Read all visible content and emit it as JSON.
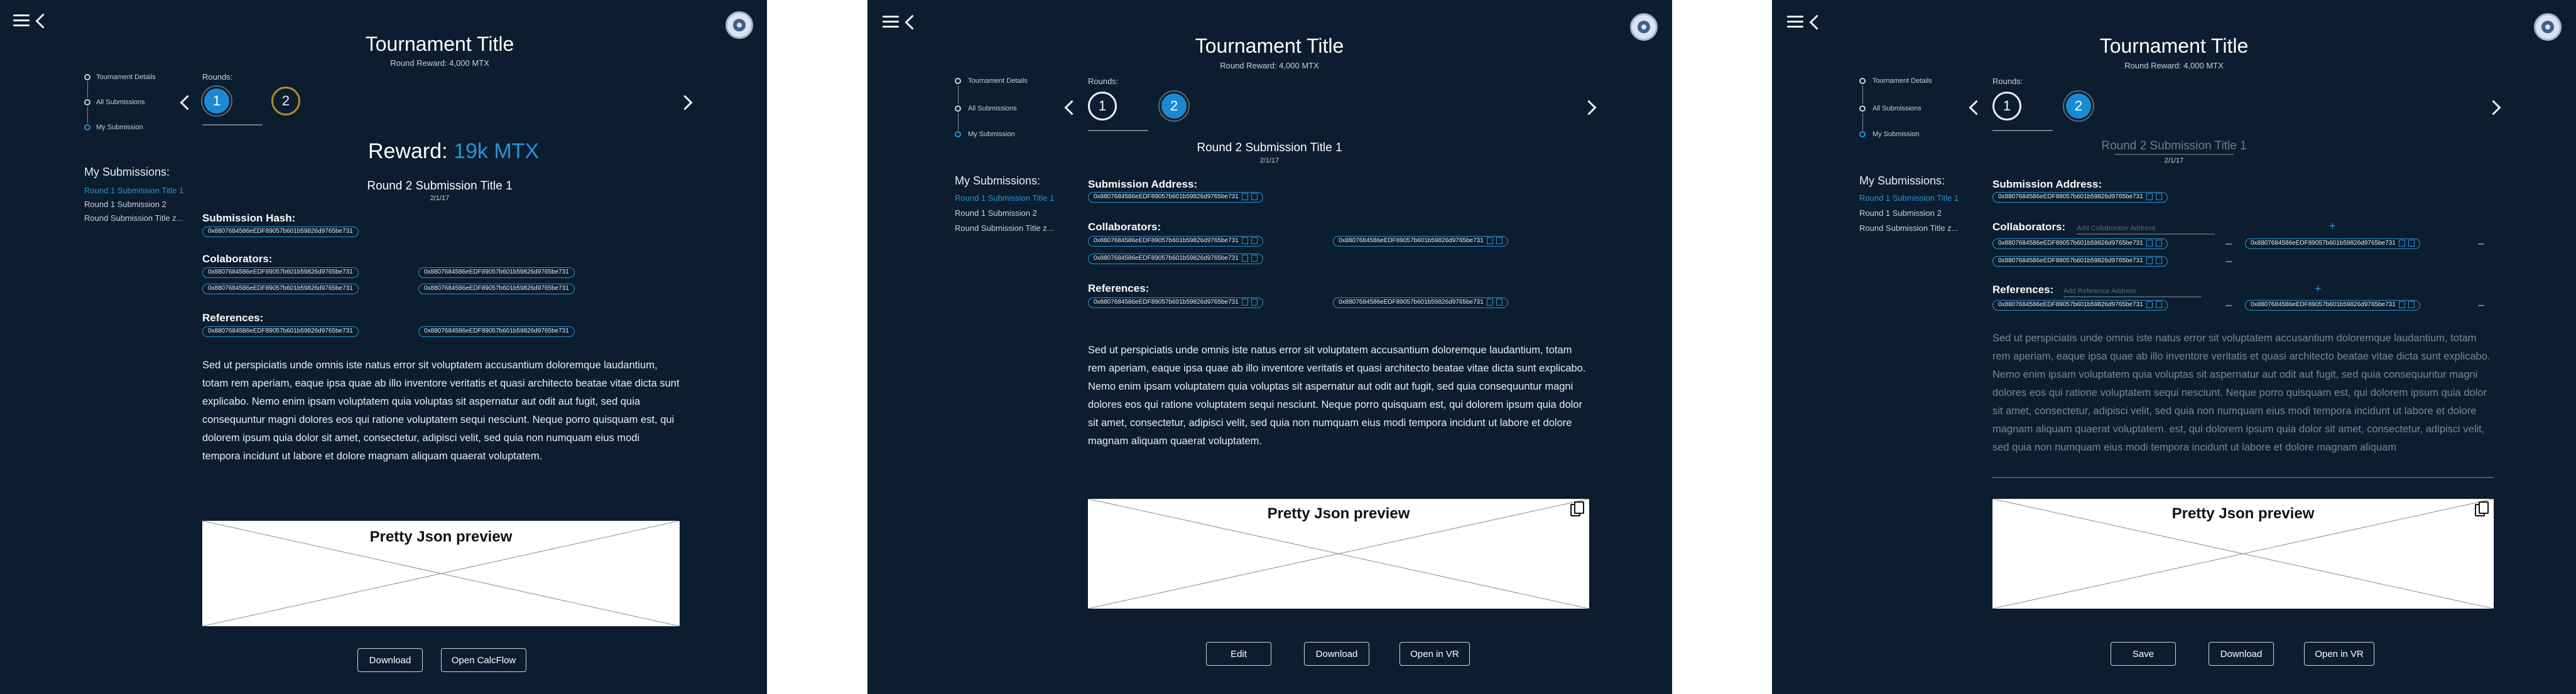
{
  "tournament": {
    "title": "Tournament Title",
    "round_reward": "Round Reward: 4,000 MTX"
  },
  "nav": {
    "tournament_details": "Tournament Details",
    "all_submissions": "All Submissions",
    "my_submission": "My Submission"
  },
  "rounds": {
    "label": "Rounds:",
    "one": "1",
    "two": "2"
  },
  "my_submissions": {
    "heading": "My Submissions:",
    "items": [
      "Round 1 Submission Title 1",
      "Round 1 Submission 2",
      "Round Submission Title z..."
    ]
  },
  "reward": {
    "label": "Reward: ",
    "amount": "19k MTX"
  },
  "submission": {
    "title": "Round 2 Submission Title 1",
    "date": "2/1/17",
    "hash_label": "Submission Hash:",
    "address_label": "Submission Address:",
    "collaborators_label": "Colaborators:",
    "collaborators_label_alt": "Collaborators:",
    "references_label": "References:",
    "hash": "0x8807684586eEDF89057b601b59826d9765be731",
    "add_collaborator_placeholder": "Add Collaborator Address",
    "add_reference_placeholder": "Add Reference Address",
    "description": "Sed ut perspiciatis unde omnis iste natus error sit voluptatem accusantium doloremque laudantium, totam rem aperiam, eaque ipsa quae ab illo inventore veritatis et quasi architecto beatae vitae dicta sunt explicabo. Nemo enim ipsam voluptatem quia voluptas sit aspernatur aut odit aut fugit, sed quia consequuntur magni dolores eos qui ratione voluptatem sequi nesciunt. Neque porro quisquam est, qui dolorem ipsum quia dolor sit amet, consectetur, adipisci velit, sed quia non numquam eius modi tempora incidunt ut labore et dolore magnam aliquam quaerat voluptatem.",
    "description_edit": "Sed ut perspiciatis unde omnis iste natus error sit voluptatem accusantium doloremque laudantium, totam rem aperiam, eaque ipsa quae ab illo inventore veritatis et quasi architecto beatae vitae dicta sunt explicabo. Nemo enim ipsam voluptatem quia voluptas sit aspernatur aut odit aut fugit, sed quia consequuntur magni dolores eos qui ratione voluptatem sequi nesciunt. Neque porro quisquam est, qui dolorem ipsum quia dolor sit amet, consectetur, adipisci velit, sed quia non numquam eius modi tempora incidunt ut labore et dolore magnam aliquam quaerat voluptatem. est, qui dolorem ipsum quia dolor sit amet, consectetur, adipisci velit, sed quia non numquam eius modi tempora incidunt ut labore et dolore magnam aliquam"
  },
  "json_preview": {
    "title": "Pretty Json preview"
  },
  "buttons": {
    "download": "Download",
    "open_calcflow": "Open CalcFlow",
    "edit": "Edit",
    "open_in_vr": "Open in VR",
    "save": "Save"
  },
  "colors": {
    "background": "#0b1d2e",
    "accent": "#2a93d8",
    "gold": "#b7892a"
  },
  "icons": [
    "menu-icon",
    "back-arrow-icon",
    "avatar-icon",
    "chevron-left-icon",
    "chevron-right-icon",
    "copy-icon",
    "external-link-icon",
    "plus-icon",
    "minus-icon"
  ]
}
